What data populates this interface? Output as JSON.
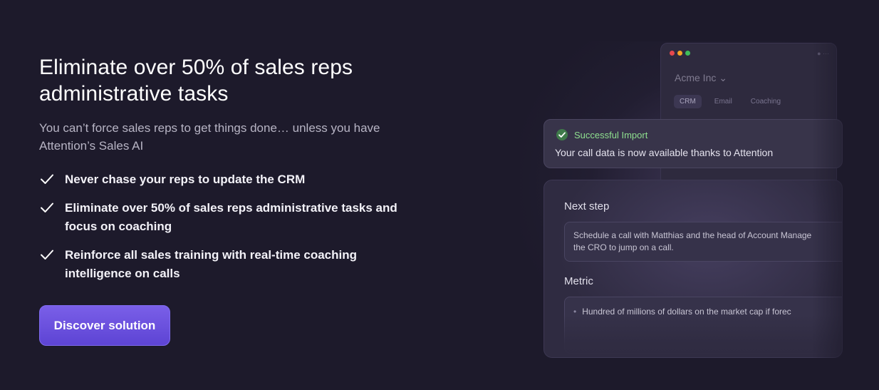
{
  "hero": {
    "headline": "Eliminate over 50% of sales reps administrative tasks",
    "subhead": "You can’t force sales reps to get things done… unless you have Attention’s Sales AI",
    "features": [
      "Never chase your reps to update the CRM",
      "Eliminate over 50% of sales reps administrative tasks and focus on coaching",
      "Reinforce all sales training with real-time coaching intelligence on calls"
    ],
    "cta_label": "Discover solution"
  },
  "mockup": {
    "window_dots": [
      "#e5484d",
      "#f5a524",
      "#3fbf5a"
    ],
    "company_name": "Acme Inc",
    "tabs": [
      "CRM",
      "Email",
      "Coaching"
    ],
    "toast": {
      "status": "Successful Import",
      "message": "Your call data is now available thanks to Attention"
    },
    "next_step": {
      "label": "Next step",
      "text_line1": "Schedule a call with Matthias and the head of Account Manage",
      "text_line2": "the CRO to jump on a call."
    },
    "metric": {
      "label": "Metric",
      "items": [
        "Hundred of millions of dollars on the market cap if forec"
      ]
    }
  },
  "colors": {
    "background": "#1d1a2b",
    "accent": "#6a50e0",
    "success": "#8fe08f"
  }
}
